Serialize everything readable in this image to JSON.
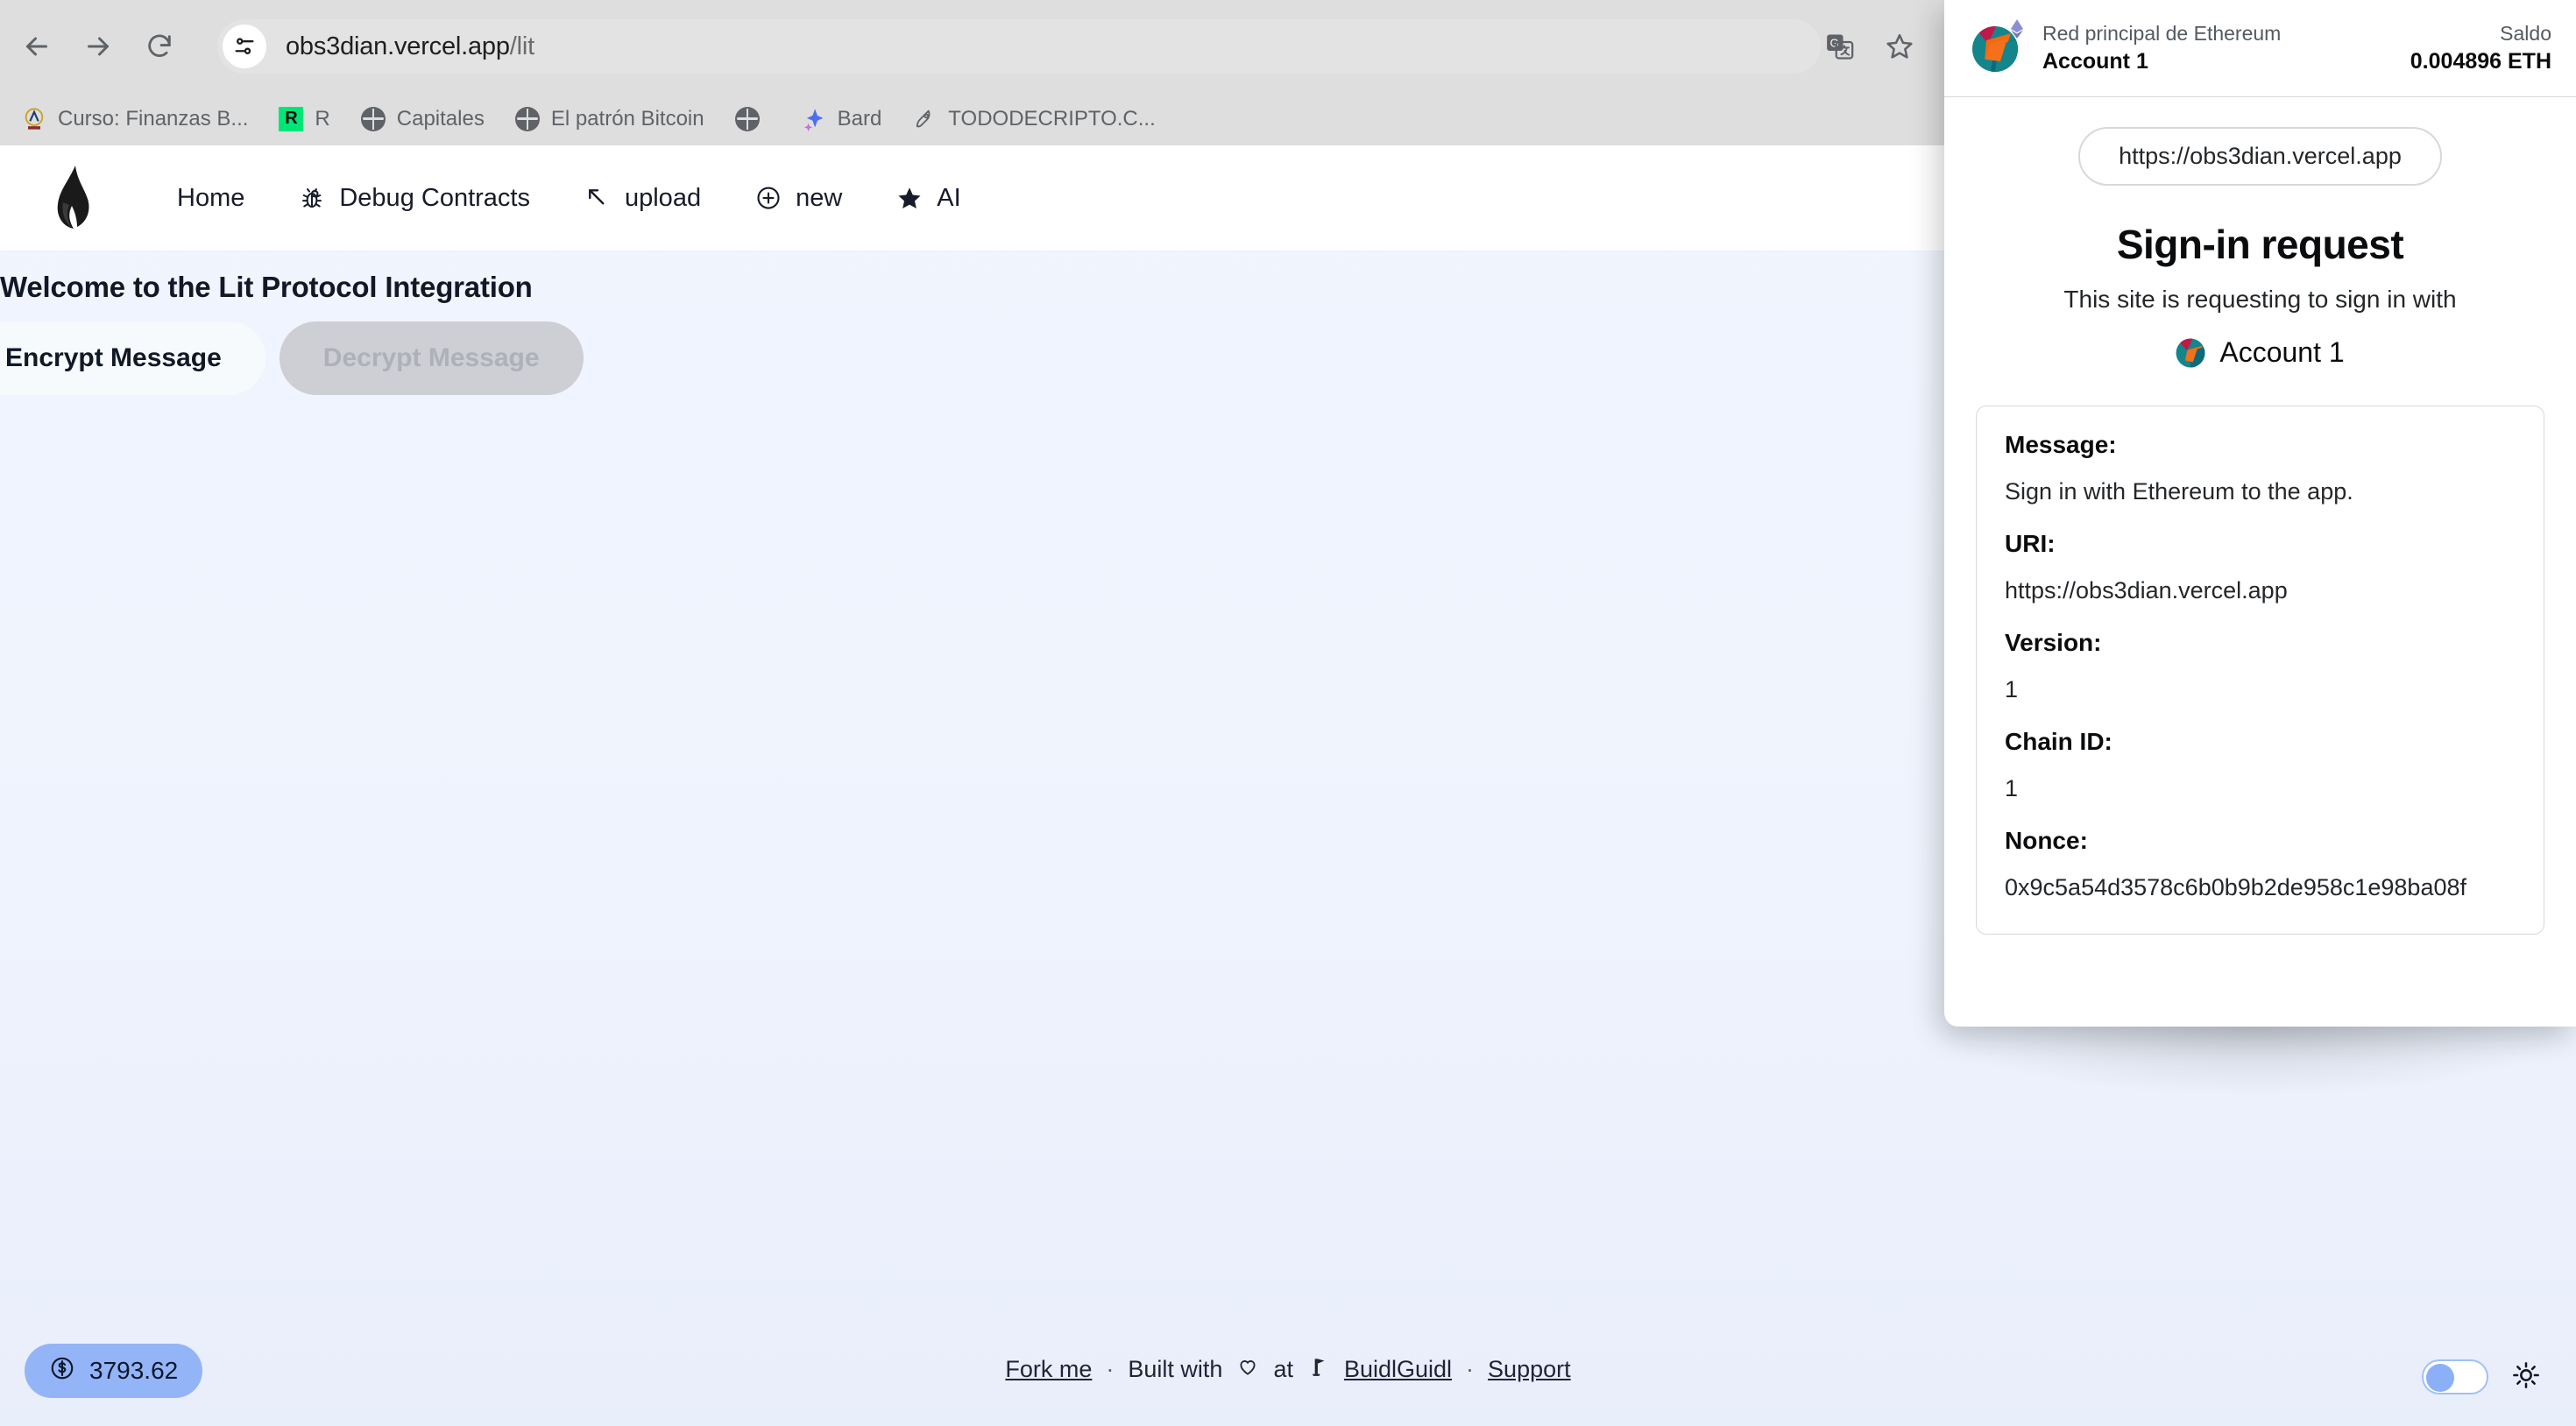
{
  "browser": {
    "back_icon": "back-arrow-icon",
    "forward_icon": "forward-arrow-icon",
    "reload_icon": "reload-icon",
    "site_info_icon": "site-settings-icon",
    "url_host": "obs3dian.vercel.app",
    "url_path": "/lit",
    "url_full": "obs3dian.vercel.app/lit",
    "translate_icon": "translate-icon",
    "bookmark_star_icon": "bookmark-star-icon",
    "bookmarks": [
      {
        "label": "Curso: Finanzas B...",
        "icon": "university-logo-favicon"
      },
      {
        "label": "R",
        "icon": "green-square-favicon"
      },
      {
        "label": "Capitales",
        "icon": "globe-favicon"
      },
      {
        "label": "El patrón Bitcoin",
        "icon": "globe-favicon"
      },
      {
        "label": "",
        "icon": "globe-favicon"
      },
      {
        "label": "Bard",
        "icon": "bard-sparkle-favicon"
      },
      {
        "label": "TODODECRIPTO.C...",
        "icon": "rocket-favicon"
      }
    ]
  },
  "site": {
    "logo_icon": "flame-logo-icon",
    "nav": [
      {
        "label": "Home",
        "icon": ""
      },
      {
        "label": "Debug Contracts",
        "icon": "bug-icon"
      },
      {
        "label": "upload",
        "icon": "arrow-up-left-icon"
      },
      {
        "label": "new",
        "icon": "plus-circle-icon"
      },
      {
        "label": "AI",
        "icon": "star-icon"
      }
    ],
    "page_title": "Welcome to the Lit Protocol Integration",
    "tabs": [
      {
        "label": "Encrypt Message",
        "state": "active"
      },
      {
        "label": "Decrypt Message",
        "state": "disabled"
      }
    ],
    "footer": {
      "fork_me": "Fork me",
      "sep1": "·",
      "built_with_prefix": "Built with",
      "heart_icon": "heart-icon",
      "built_with_at": "at",
      "buidlguidl_icon": "buidlguidl-icon",
      "buidlguidl": "BuidlGuidl",
      "sep2": "·",
      "support": "Support",
      "price_icon": "dollar-circle-icon",
      "price": "3793.62",
      "theme_toggle_state": "off",
      "sun_icon": "sun-icon"
    }
  },
  "metamask": {
    "avatar_icon": "account-jazzicon",
    "network_badge_icon": "ethereum-diamond-icon",
    "network": "Red principal de Ethereum",
    "account_name": "Account 1",
    "balance_label": "Saldo",
    "balance_value": "0.004896 ETH",
    "origin": "https://obs3dian.vercel.app",
    "title": "Sign-in request",
    "subtitle": "This site is requesting to sign in with",
    "signing_account": "Account 1",
    "details": [
      {
        "key": "Message:",
        "value": "Sign in with Ethereum to the app."
      },
      {
        "key": "URI:",
        "value": "https://obs3dian.vercel.app"
      },
      {
        "key": "Version:",
        "value": "1"
      },
      {
        "key": "Chain ID:",
        "value": "1"
      },
      {
        "key": "Nonce:",
        "value": "0x9c5a54d3578c6b0b9b2de958c1e98ba08f"
      }
    ]
  },
  "colors": {
    "accent_blue": "#93b4f7",
    "page_bg": "#f1f5fe",
    "chrome_bg": "#dedede",
    "text_dark": "#0b0c0e"
  }
}
